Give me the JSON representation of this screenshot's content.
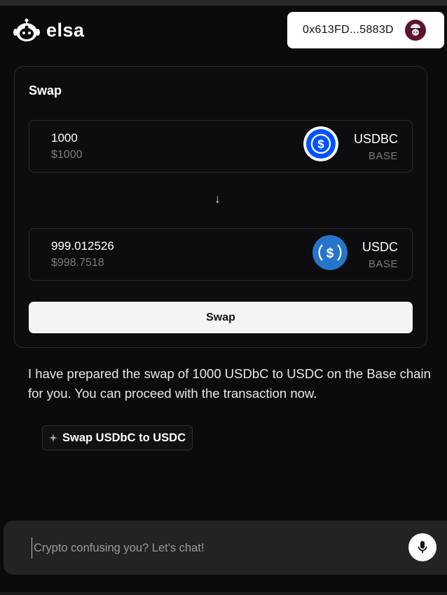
{
  "app": {
    "name": "elsa"
  },
  "wallet": {
    "address": "0x613FD...5883D"
  },
  "swap": {
    "title": "Swap",
    "from": {
      "amount": "1000",
      "usd": "$1000",
      "symbol": "USDBC",
      "chain": "BASE"
    },
    "to": {
      "amount": "999.012526",
      "usd": "$998.7518",
      "symbol": "USDC",
      "chain": "BASE"
    },
    "arrow": "↓",
    "button_label": "Swap"
  },
  "message": {
    "text": "I have prepared the swap of 1000 USDbC to USDC on the Base chain for you. You can proceed with the transaction now."
  },
  "suggestion": {
    "label": "Swap USDbC to USDC",
    "icon": "sparkle-icon"
  },
  "chat": {
    "placeholder": "Crypto confusing you? Let's chat!",
    "mic_icon": "microphone-icon"
  },
  "colors": {
    "background": "#0b0b0c",
    "usdbc_blue": "#0052ff",
    "usdc_blue": "#2775ca",
    "avatar_bg": "#5a1430"
  }
}
